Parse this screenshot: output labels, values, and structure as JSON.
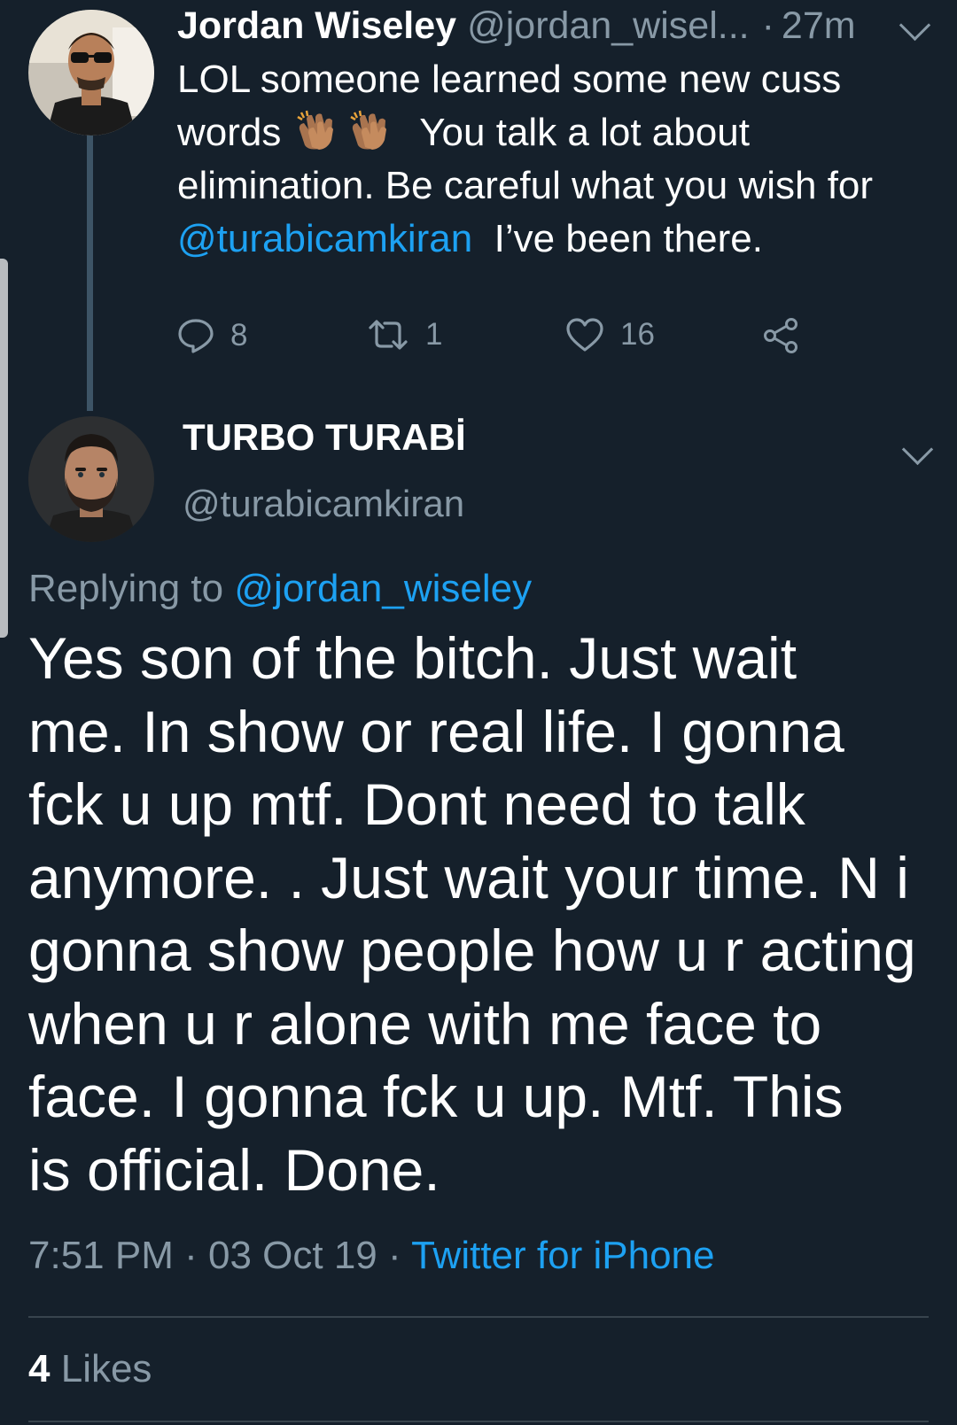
{
  "tweet1": {
    "author_name": "Jordan Wiseley",
    "handle": "@jordan_wisel...",
    "separator": "·",
    "time": "27m",
    "lines": [
      {
        "text": "LOL someone learned some new cuss"
      },
      {
        "before": "words ",
        "emoji": [
          "clapping-hands-emoji",
          "clapping-hands-emoji"
        ],
        "after": "  You talk a lot about"
      },
      {
        "text": "elimination. Be careful what you wish for"
      },
      {
        "mention": "@turabicamkiran",
        "after": "  I’ve been there."
      }
    ],
    "actions": {
      "reply_count": "8",
      "retweet_count": "1",
      "like_count": "16"
    }
  },
  "tweet2": {
    "author_name": "TURBO TURABİ",
    "handle": "@turabicamkiran",
    "replying_label": "Replying to",
    "replying_handle": "@jordan_wiseley",
    "lines": [
      "Yes son of the bitch. Just wait",
      "me. In show or real life. I gonna",
      "fck u up mtf. Dont need to talk",
      "anymore. . Just wait your time. N i",
      "gonna show people how u r acting",
      "when u r alone with me face to",
      "face. I gonna fck u up. Mtf. This",
      "is official. Done."
    ],
    "time": "7:51 PM",
    "date": "03 Oct 19",
    "separator": "·",
    "source": "Twitter for iPhone",
    "likes_count": "4",
    "likes_label": "Likes"
  },
  "colors": {
    "background": "#15202b",
    "text": "#ffffff",
    "secondary": "#8899a6",
    "link": "#1da1f2",
    "divider": "#38444d"
  },
  "icons": [
    "reply-icon",
    "retweet-icon",
    "heart-icon",
    "share-icon",
    "chevron-down-icon"
  ]
}
